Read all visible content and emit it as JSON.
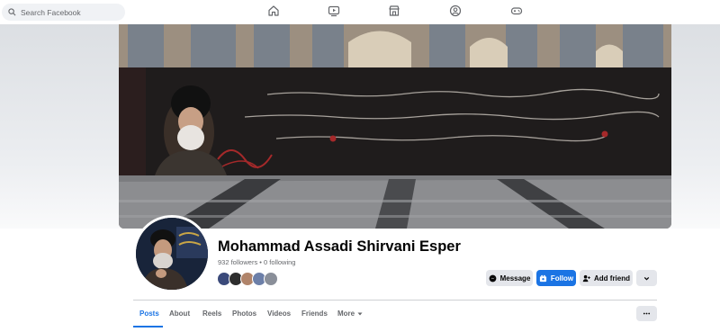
{
  "search": {
    "placeholder": "Search Facebook"
  },
  "nav_icons": [
    "home-icon",
    "video-icon",
    "marketplace-icon",
    "groups-icon",
    "gaming-icon"
  ],
  "profile": {
    "name": "Mohammad Assadi Shirvani Esper",
    "followers": "932 followers",
    "separator": "•",
    "following": "0 following"
  },
  "actions": {
    "message": "Message",
    "follow": "Follow",
    "add_friend": "Add friend"
  },
  "tabs": [
    "Posts",
    "About",
    "Reels",
    "Photos",
    "Videos",
    "Friends",
    "More"
  ],
  "colors": {
    "accent": "#1b74e4",
    "secondary_button": "#e4e6eb",
    "muted_text": "#65676b"
  }
}
